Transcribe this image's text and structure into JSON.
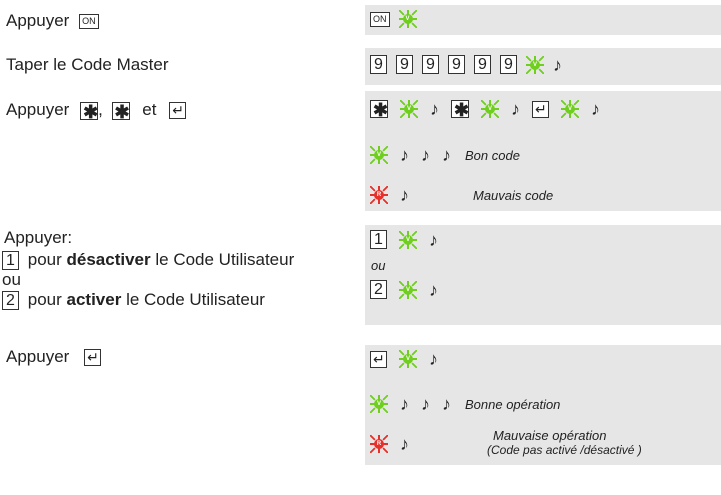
{
  "steps": {
    "s1": {
      "text": "Appuyer",
      "key": "ON"
    },
    "s2": {
      "text": "Taper le Code Master"
    },
    "s3": {
      "text": "Appuyer",
      "comma": ",",
      "and": "et"
    },
    "s4": {
      "line1": "Appuyer:",
      "opt1_pre": "pour",
      "opt1_bold": "désactiver",
      "opt1_post": "le Code Utilisateur",
      "or": "ou",
      "opt2_pre": "pour",
      "opt2_bold": "activer",
      "opt2_post": "le Code Utilisateur"
    },
    "s5": {
      "text": "Appuyer"
    }
  },
  "keys": {
    "on": "ON",
    "digit_9": "9",
    "digit_1": "1",
    "digit_2": "2",
    "star": "✱",
    "enter": "↵"
  },
  "leds": {
    "green_letter": "V",
    "red_letter": "R",
    "green_color": "#6fce1e",
    "red_color": "#e8302a"
  },
  "note_symbol": "♪",
  "results": {
    "bon_code": "Bon code",
    "mauvais_code": "Mauvais code",
    "ou": "ou",
    "bonne_operation": "Bonne opération",
    "mauvaise_operation": "Mauvaise opération",
    "mauvaise_operation_detail": "(Code pas activé /désactivé )"
  }
}
